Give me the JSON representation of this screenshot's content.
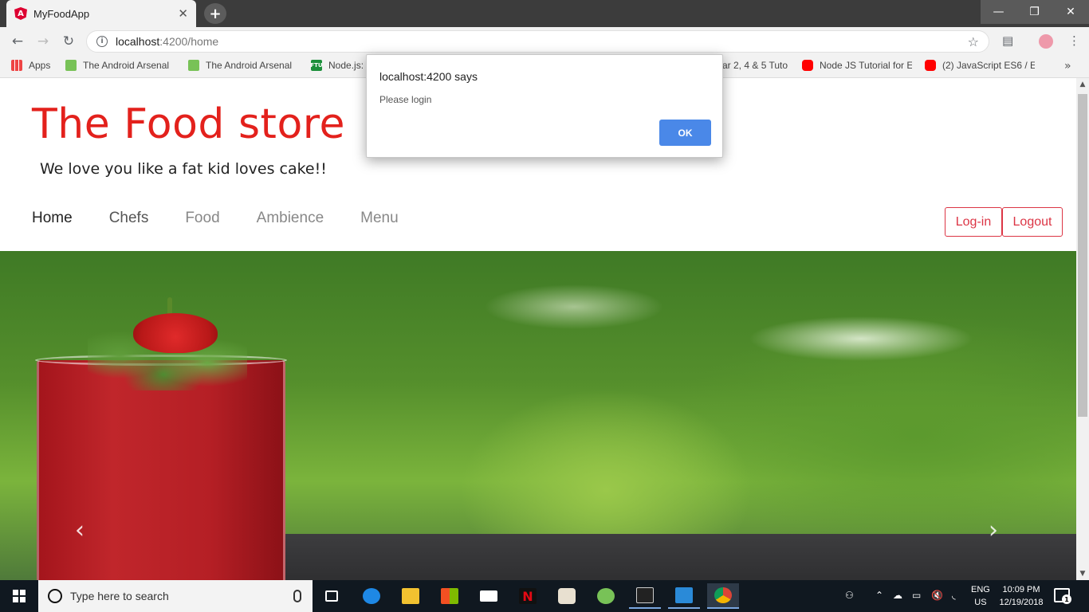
{
  "browser": {
    "tab_title": "MyFoodApp",
    "tab_close": "✕",
    "new_tab": "+",
    "window_buttons": {
      "minimize": "—",
      "maximize": "❐",
      "close": "✕"
    },
    "nav": {
      "back": "←",
      "forward": "→",
      "reload": "↻"
    },
    "url_host": "localhost",
    "url_path": ":4200/home",
    "star": "☆",
    "bookmarks": [
      {
        "label": "Apps",
        "icon": "apps"
      },
      {
        "label": "The Android Arsenal",
        "icon": "android"
      },
      {
        "label": "The Android Arsenal",
        "icon": "android"
      },
      {
        "label": "Node.js:",
        "icon": "ftu"
      },
      {
        "label": "ar 2, 4 & 5 Tuto",
        "icon": "none"
      },
      {
        "label": "Node JS Tutorial for E",
        "icon": "youtube"
      },
      {
        "label": "(2) JavaScript ES6 / E",
        "icon": "youtube"
      }
    ],
    "bookmarks_more": "»"
  },
  "site": {
    "title": "The Food store",
    "tagline": "We love you like a fat kid loves cake!!",
    "nav": [
      {
        "label": "Home",
        "state": "active"
      },
      {
        "label": "Chefs",
        "state": "dark"
      },
      {
        "label": "Food",
        "state": "muted"
      },
      {
        "label": "Ambience",
        "state": "muted"
      },
      {
        "label": "Menu",
        "state": "muted"
      }
    ],
    "login_label": "Log-in",
    "logout_label": "Logout",
    "carousel_prev": "‹",
    "carousel_next": "›"
  },
  "dialog": {
    "title": "localhost:4200 says",
    "message": "Please login",
    "ok_label": "OK"
  },
  "taskbar": {
    "search_placeholder": "Type here to search",
    "lang_line1": "ENG",
    "lang_line2": "US",
    "time": "10:09 PM",
    "date": "12/19/2018",
    "notification_count": "1"
  },
  "colors": {
    "brand_red": "#e3211c",
    "button_red": "#dc3545",
    "ok_blue": "#4a88e8",
    "taskbar": "#101820"
  }
}
